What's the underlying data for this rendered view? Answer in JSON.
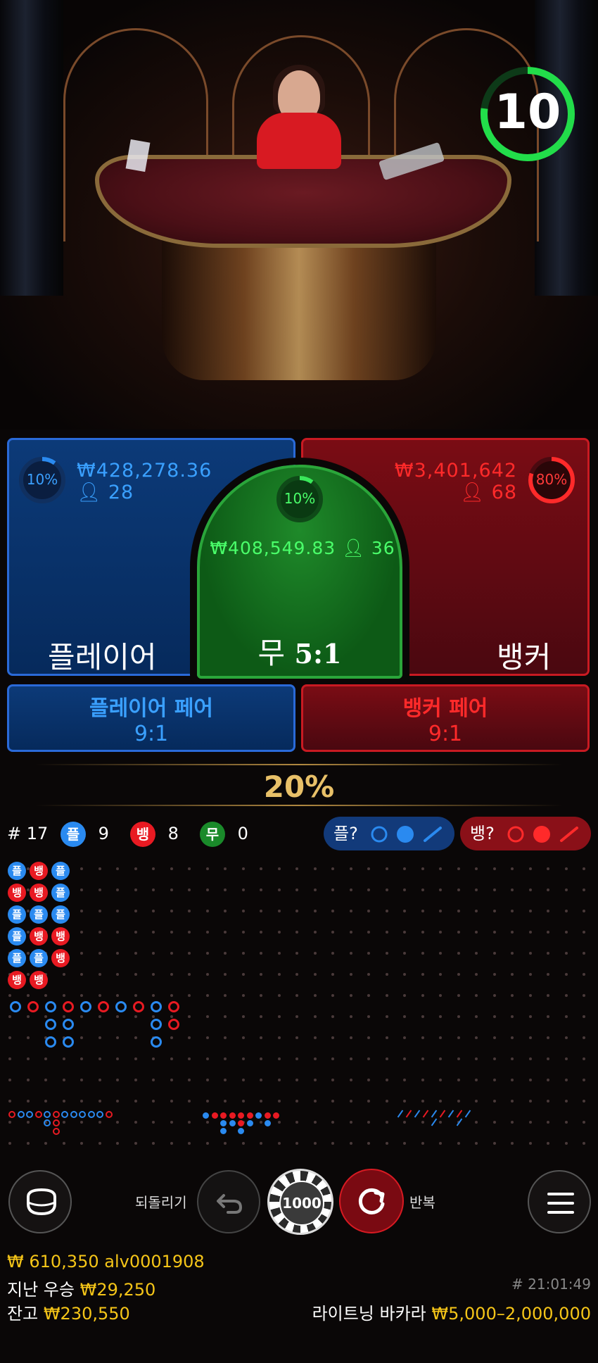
{
  "timer": {
    "value": "10"
  },
  "bets": {
    "player": {
      "label": "플레이어",
      "pct": "10%",
      "amount": "₩428,278.36",
      "players": "28",
      "fill": 0.1
    },
    "tie": {
      "label": "무",
      "payout": "5:1",
      "pct": "10%",
      "amount": "₩408,549.83",
      "players": "36",
      "fill": 0.1
    },
    "banker": {
      "label": "뱅커",
      "pct": "80%",
      "amount": "₩3,401,642",
      "players": "68",
      "fill": 0.8
    },
    "player_pair": {
      "label": "플레이어 페어",
      "payout": "9:1"
    },
    "banker_pair": {
      "label": "뱅커 페어",
      "payout": "9:1"
    }
  },
  "multiplier": "20%",
  "stats": {
    "round": "# 17",
    "player_badge": "플",
    "player_count": "9",
    "banker_badge": "뱅",
    "banker_count": "8",
    "tie_badge": "무",
    "tie_count": "0"
  },
  "predict": {
    "player": "플?",
    "banker": "뱅?"
  },
  "bead_road": [
    [
      "P",
      "B",
      "P"
    ],
    [
      "B",
      "B",
      "P"
    ],
    [
      "P",
      "P",
      "P"
    ],
    [
      "P",
      "B",
      "B"
    ],
    [
      "P",
      "P",
      "B"
    ],
    [
      "B",
      "B"
    ]
  ],
  "controls": {
    "undo_label": "되돌리기",
    "chip_value": "1000",
    "repeat_label": "반복"
  },
  "footer": {
    "balance_line": "₩ 610,350 alv0001908",
    "last_win_label": "지난 우승",
    "last_win_value": "₩29,250",
    "balance_label": "잔고",
    "balance_value": "₩230,550",
    "round_time": "# 21:01:49",
    "game_name": "라이트닝 바카라",
    "limits": "₩5,000–2,000,000"
  },
  "colors": {
    "player": "#2a8af0",
    "banker": "#e81a22",
    "tie": "#22b83a",
    "gold": "#f5c518"
  }
}
